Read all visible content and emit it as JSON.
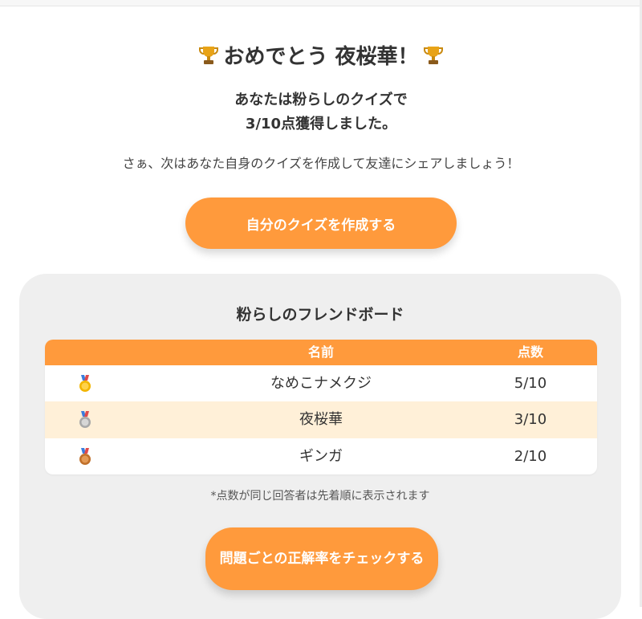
{
  "congrats": {
    "title": "おめでとう 夜桜華！"
  },
  "result": {
    "line1": "あなたは粉らしのクイズで",
    "line2": "3/10点獲得しました。"
  },
  "invite_text": "さぁ、次はあなた自身のクイズを作成して友達にシェアしましょう！",
  "create_button_label": "自分のクイズを作成する",
  "leaderboard": {
    "title": "粉らしのフレンドボード",
    "columns": {
      "name": "名前",
      "score": "点数"
    },
    "rows": [
      {
        "medal": "gold",
        "name": "なめこナメクジ",
        "score": "5/10"
      },
      {
        "medal": "silver",
        "name": "夜桜華",
        "score": "3/10"
      },
      {
        "medal": "bronze",
        "name": "ギンガ",
        "score": "2/10"
      }
    ],
    "note": "*点数が同じ回答者は先着順に表示されます"
  },
  "check_button_label": "問題ごとの正解率をチェックする",
  "colors": {
    "accent": "#ff9a3c",
    "highlight_row": "#fff0d8",
    "panel": "#efefef"
  }
}
